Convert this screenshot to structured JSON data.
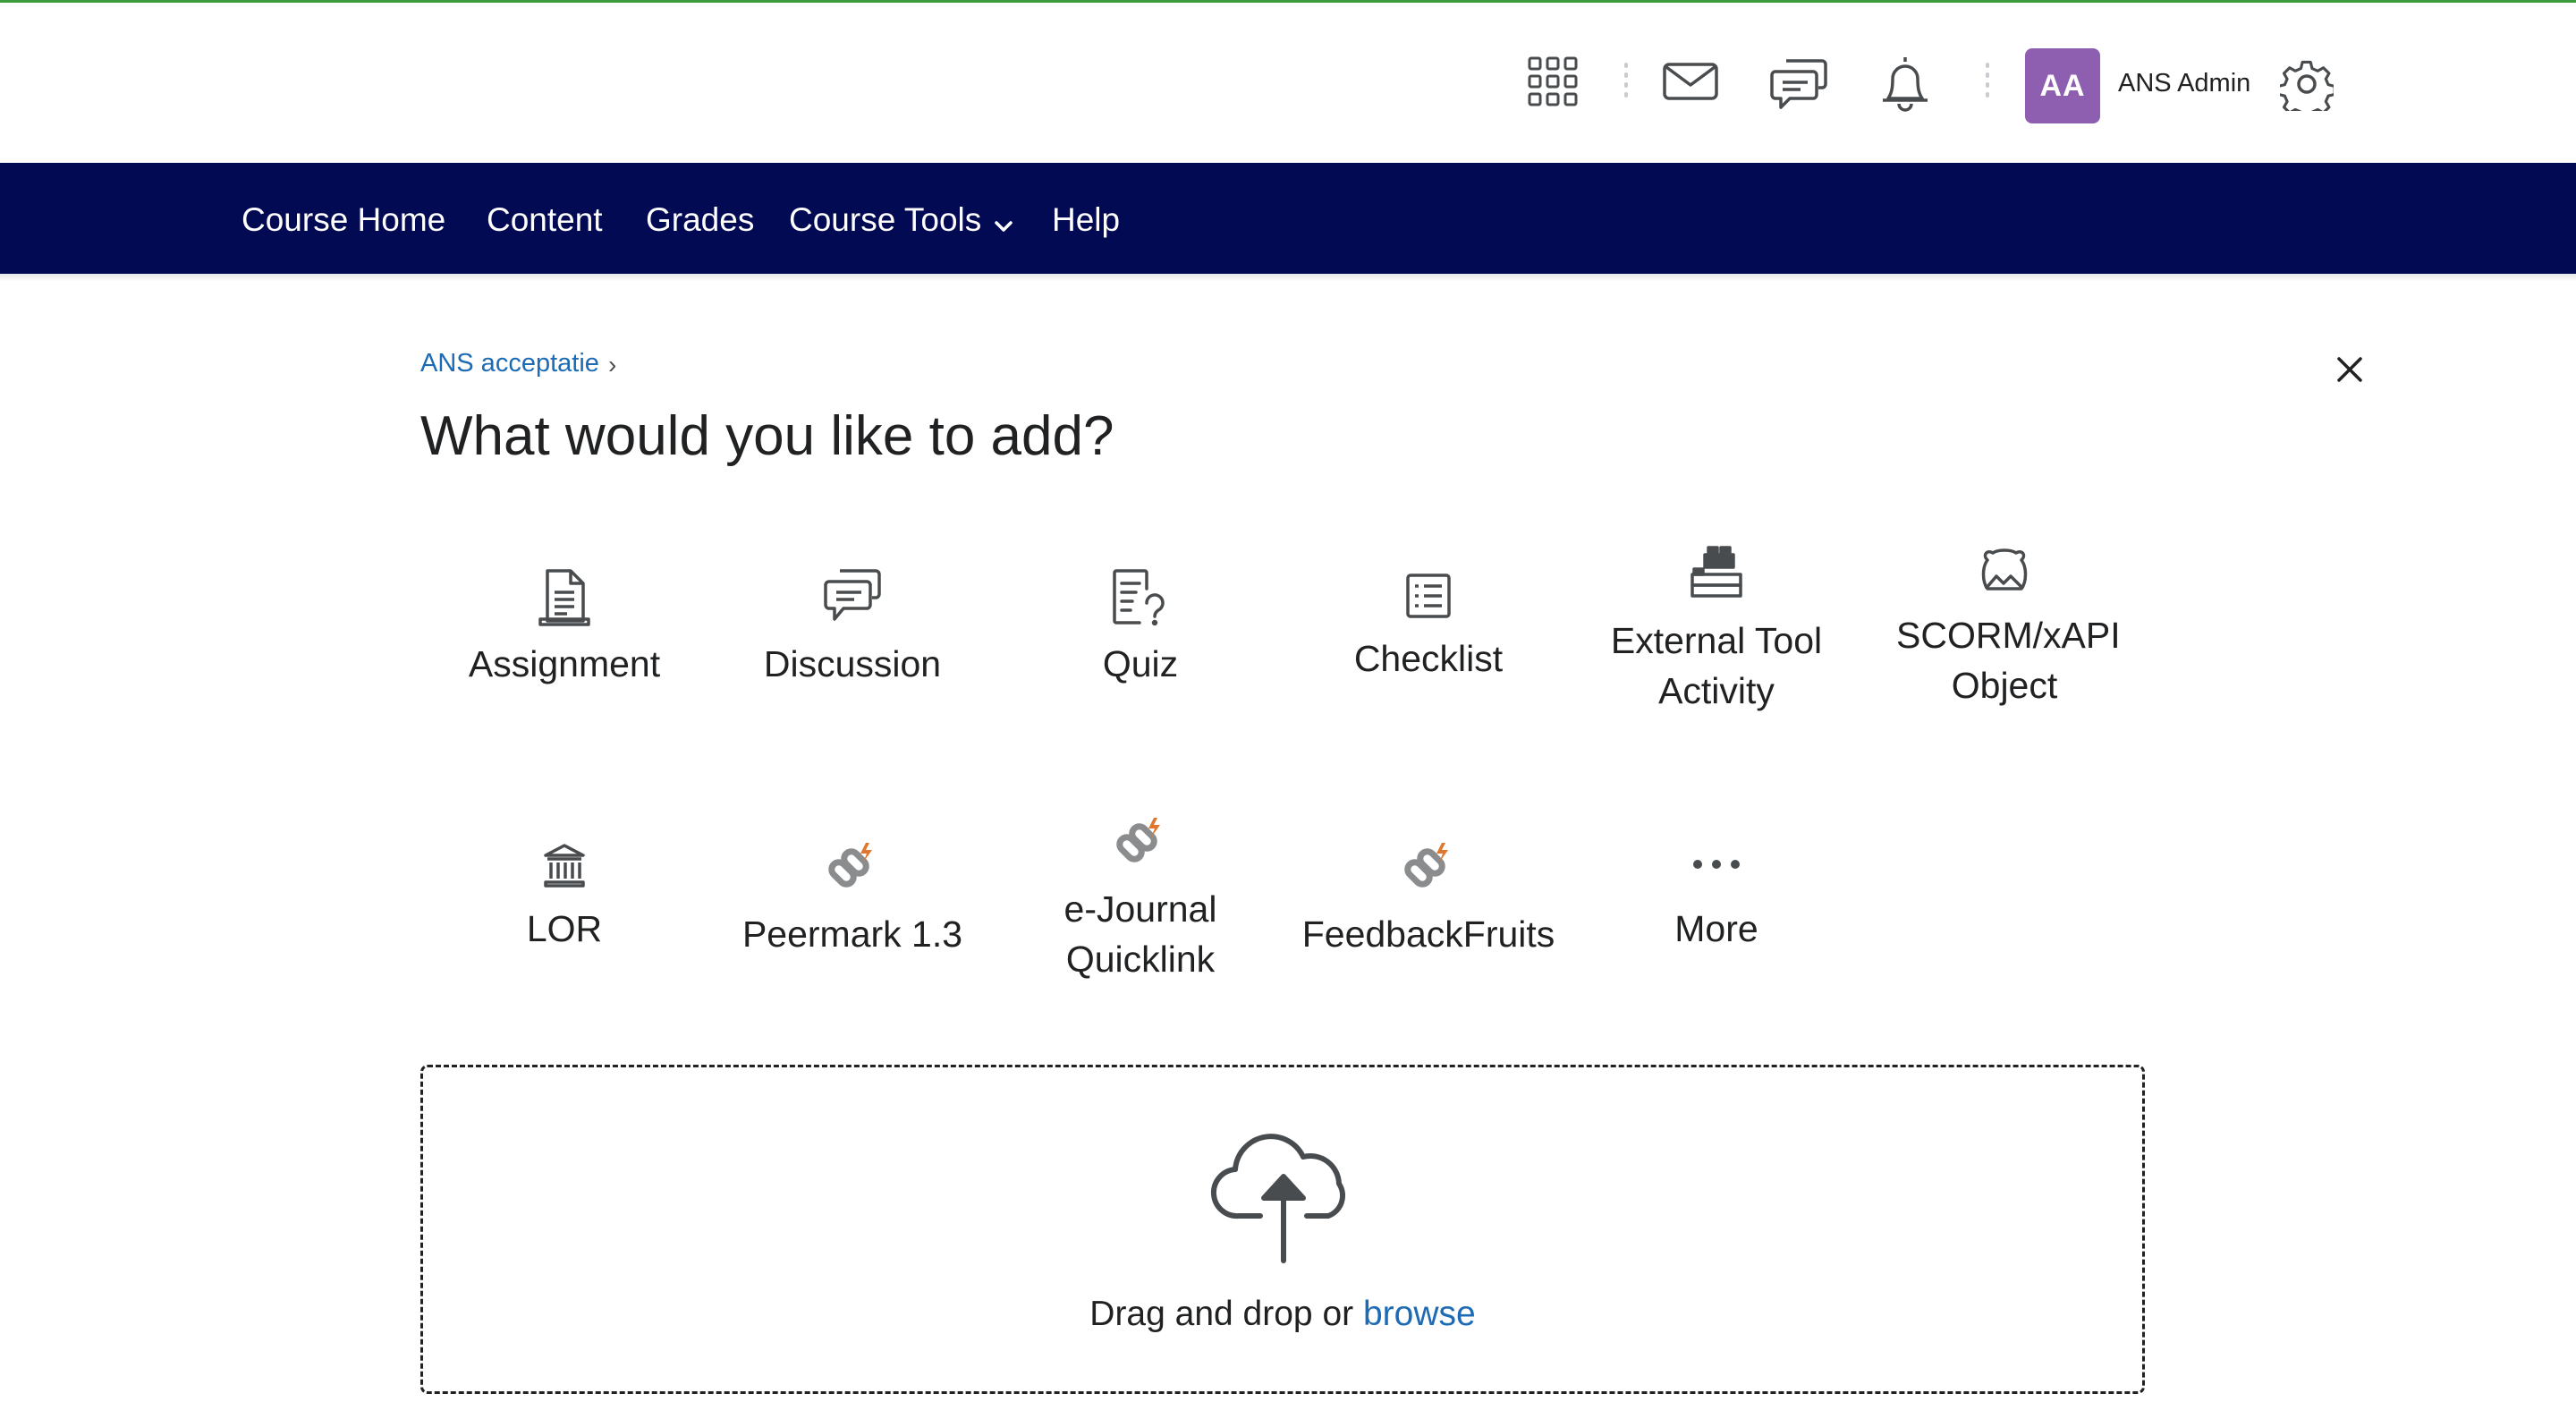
{
  "header": {
    "icons": [
      "apps-grid-icon",
      "mail-icon",
      "chat-icon",
      "bell-icon",
      "gear-icon"
    ],
    "user_initials": "AA",
    "user_name": "ANS Admin",
    "avatar_color": "#8e5fb0"
  },
  "navbar": {
    "background": "#020a53",
    "items": [
      {
        "label": "Course Home"
      },
      {
        "label": "Content"
      },
      {
        "label": "Grades"
      },
      {
        "label": "Course Tools"
      },
      {
        "label": "Help"
      }
    ]
  },
  "breadcrumb": {
    "label": "ANS acceptatie"
  },
  "page": {
    "title": "What would you like to add?"
  },
  "tiles": [
    {
      "label": "Assignment",
      "icon": "assignment-icon"
    },
    {
      "label": "Discussion",
      "icon": "discussion-icon"
    },
    {
      "label": "Quiz",
      "icon": "quiz-icon"
    },
    {
      "label": "Checklist",
      "icon": "checklist-icon"
    },
    {
      "label": "External Tool Activity",
      "icon": "lego-block-icon"
    },
    {
      "label": "SCORM/xAPI Object",
      "icon": "scorm-icon"
    },
    {
      "label": "LOR",
      "icon": "bank-icon"
    },
    {
      "label": "Peermark 1.3",
      "icon": "link-bolt-icon"
    },
    {
      "label": "e-Journal Quicklink",
      "icon": "link-bolt-icon"
    },
    {
      "label": "FeedbackFruits",
      "icon": "link-bolt-icon"
    },
    {
      "label": "More",
      "icon": "more-icon"
    }
  ],
  "dropzone": {
    "text": "Drag and drop or",
    "link": "browse",
    "icon": "cloud-upload-icon"
  }
}
